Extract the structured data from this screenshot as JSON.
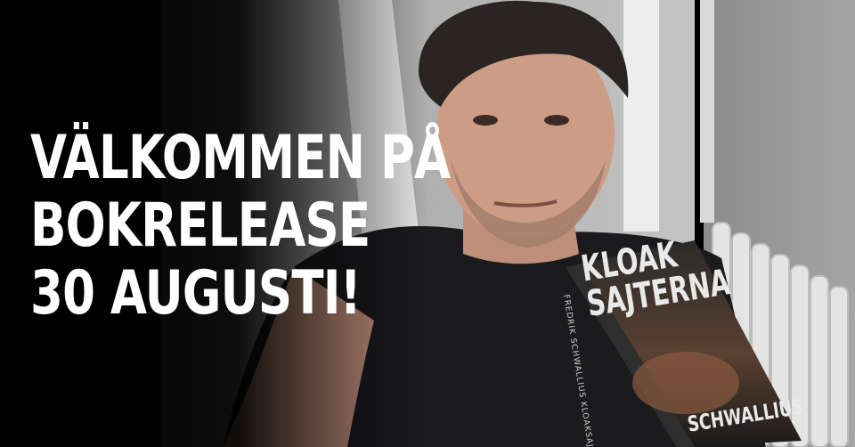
{
  "headline": {
    "line1": "VÄLKOMMEN PÅ",
    "line2": "BOKRELEASE",
    "line3": "30 AUGUSTI!"
  },
  "book": {
    "title_line1": "KLOAK",
    "title_line2": "SAJTERNA",
    "author": "SCHWALLIUS",
    "spine_text": "FREDRIK SCHWALLIUS   KLOAKSAJTERNA"
  },
  "colors": {
    "background": "#000000",
    "headline_text": "#ffffff",
    "wall": "#b8b8b8",
    "shirt": "#1b1b1e",
    "skin": "#c99a83",
    "book_cover": "#1c1c1c"
  }
}
